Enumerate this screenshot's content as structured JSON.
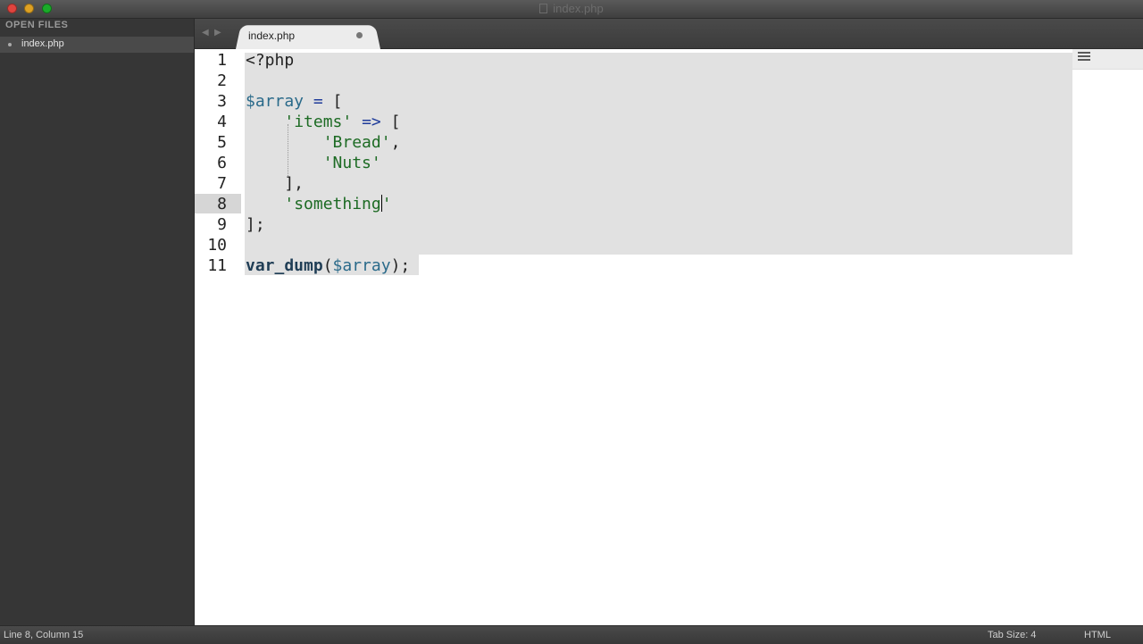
{
  "window": {
    "title": "index.php"
  },
  "sidebar": {
    "header": "OPEN FILES",
    "files": [
      {
        "label": "index.php"
      }
    ]
  },
  "tabs": {
    "prev_arrow": "◀",
    "next_arrow": "▶",
    "active": {
      "label": "index.php"
    }
  },
  "editor": {
    "line_numbers": [
      "1",
      "2",
      "3",
      "4",
      "5",
      "6",
      "7",
      "8",
      "9",
      "10",
      "11"
    ],
    "current_line": "8"
  },
  "statusbar": {
    "position": "Line 8, Column 15",
    "tab_size": "Tab Size: 4",
    "syntax": "HTML"
  }
}
